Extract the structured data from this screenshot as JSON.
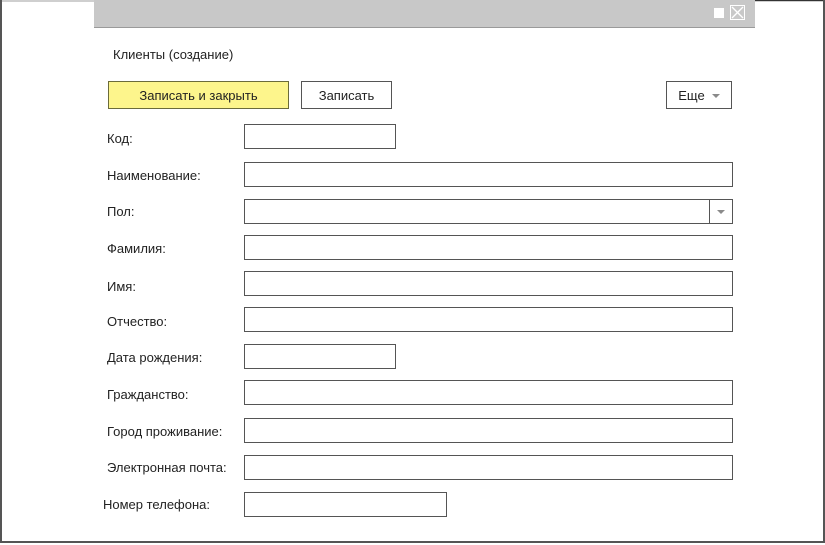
{
  "window": {
    "title": "Клиенты (создание)"
  },
  "toolbar": {
    "save_close_label": "Записать и закрыть",
    "save_label": "Записать",
    "more_label": "Еще"
  },
  "fields": {
    "code": {
      "label": "Код:",
      "value": ""
    },
    "name": {
      "label": "Наименование:",
      "value": ""
    },
    "gender": {
      "label": "Пол:",
      "value": ""
    },
    "last_name": {
      "label": "Фамилия:",
      "value": ""
    },
    "first_name": {
      "label": "Имя:",
      "value": ""
    },
    "middle_name": {
      "label": "Отчество:",
      "value": ""
    },
    "birth_date": {
      "label": "Дата рождения:",
      "value": ""
    },
    "citizenship": {
      "label": "Гражданство:",
      "value": ""
    },
    "city": {
      "label": "Город проживание:",
      "value": ""
    },
    "email": {
      "label": "Электронная почта:",
      "value": ""
    },
    "phone": {
      "label": "Номер телефона:",
      "value": ""
    }
  },
  "colors": {
    "primary_button": "#fdf58c",
    "titlebar": "#c8c8c8"
  },
  "icons": {
    "restore": "restore-icon",
    "close": "close-icon",
    "dropdown": "chevron-down-icon"
  }
}
